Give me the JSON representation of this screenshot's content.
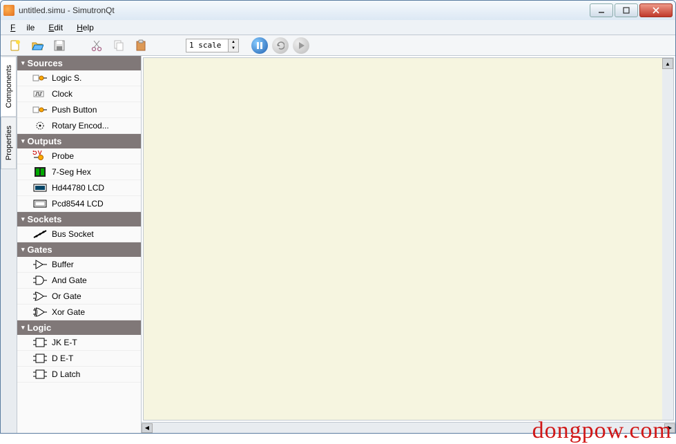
{
  "window": {
    "title": "untitled.simu - SimutronQt"
  },
  "menu": {
    "file": "File",
    "edit": "Edit",
    "help": "Help"
  },
  "toolbar": {
    "scale": "1 scale"
  },
  "vtabs": {
    "components": "Components",
    "properties": "Properties"
  },
  "categories": [
    {
      "name": "Sources",
      "items": [
        {
          "label": "Logic S.",
          "icon": "logic-source"
        },
        {
          "label": "Clock",
          "icon": "clock"
        },
        {
          "label": "Push Button",
          "icon": "push-button"
        },
        {
          "label": "Rotary Encod...",
          "icon": "rotary"
        }
      ]
    },
    {
      "name": "Outputs",
      "items": [
        {
          "label": "Probe",
          "icon": "probe"
        },
        {
          "label": "7-Seg Hex",
          "icon": "7seg"
        },
        {
          "label": "Hd44780 LCD",
          "icon": "lcd1"
        },
        {
          "label": "Pcd8544 LCD",
          "icon": "lcd2"
        }
      ]
    },
    {
      "name": "Sockets",
      "items": [
        {
          "label": "Bus Socket",
          "icon": "bus"
        }
      ]
    },
    {
      "name": "Gates",
      "items": [
        {
          "label": "Buffer",
          "icon": "buffer"
        },
        {
          "label": "And Gate",
          "icon": "and"
        },
        {
          "label": "Or Gate",
          "icon": "or"
        },
        {
          "label": "Xor Gate",
          "icon": "xor"
        }
      ]
    },
    {
      "name": "Logic",
      "items": [
        {
          "label": "JK E-T",
          "icon": "ff"
        },
        {
          "label": "D E-T",
          "icon": "ff"
        },
        {
          "label": "D Latch",
          "icon": "ff"
        }
      ]
    }
  ],
  "watermark": "dongpow.com"
}
